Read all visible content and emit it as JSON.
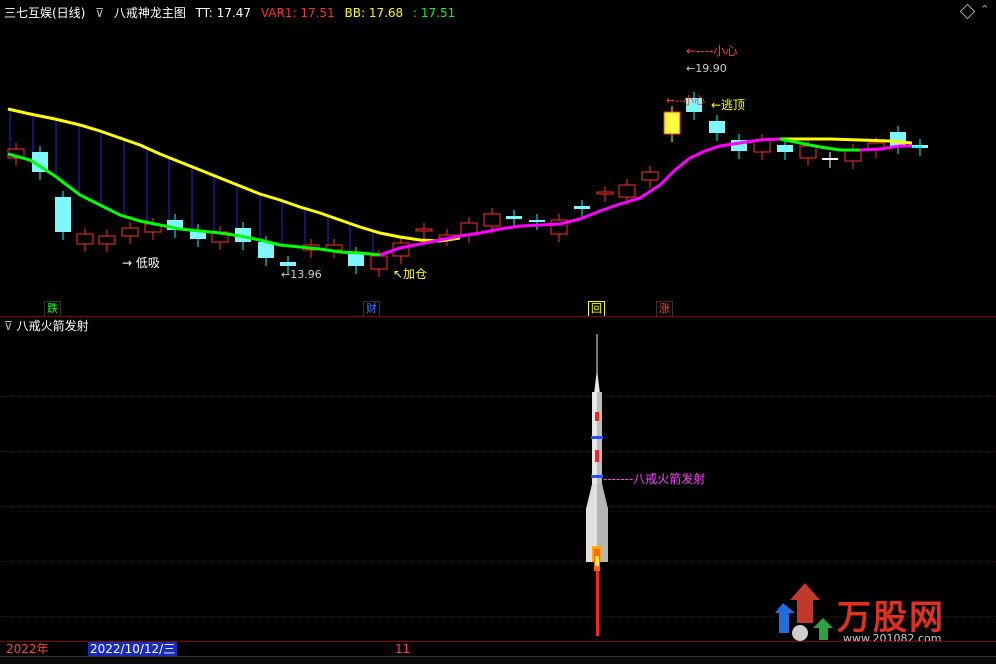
{
  "header": {
    "stock": "三七互娱(日线)",
    "indicator": "八戒神龙主图",
    "tt_label": "TT: 17.47",
    "var1_label": "VAR1: 17.51",
    "bb_label": "BB: 17.68",
    "green_label": ": 17.51",
    "colors": {
      "tt": "#ffffff",
      "var1": "#ff3030",
      "bb": "#ffff00",
      "green": "#00ff00"
    }
  },
  "main_chart": {
    "annotations": {
      "low_buy": "→ 低吸",
      "add_position": "↖加仓",
      "low_price": "←13.96",
      "high_price": "←19.90",
      "caution_top": "←----小心",
      "caution_mid": "←--小心",
      "escape_top": "←逃顶"
    },
    "signal_tags": [
      {
        "text": "跌",
        "color": "#00ff00"
      },
      {
        "text": "财",
        "color": "#3a7bff"
      },
      {
        "text": "回",
        "color": "#ffff00"
      },
      {
        "text": "涨",
        "color": "#ff4040"
      }
    ]
  },
  "sub_chart": {
    "title": "八戒火箭发射",
    "rocket_label": "-------八戒火箭发射",
    "label_color": "#ff40ff"
  },
  "date_axis": {
    "year": "2022年",
    "date": "2022/10/12/三",
    "month_tick": "11"
  },
  "watermark": {
    "brand": "万股网",
    "url": "www.201082.com"
  },
  "icons": {
    "collapse": "chevron-down-icon",
    "settings": "diamond-icon"
  }
}
